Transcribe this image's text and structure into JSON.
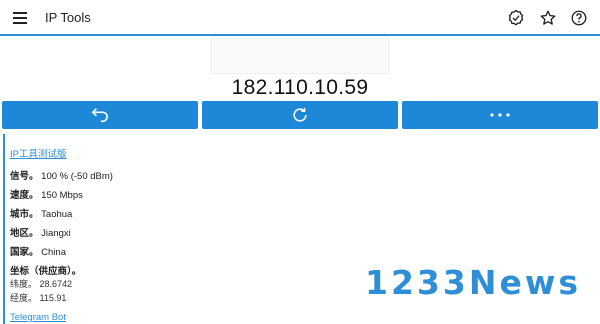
{
  "app": {
    "title": "IP Tools",
    "accent": "#2f8fd6",
    "button_color": "#1e88d8",
    "icons": {
      "menu": "hamburger-menu-icon",
      "verify": "verified-badge-icon",
      "star": "star-icon",
      "help": "help-icon",
      "back": "back-arrow-icon",
      "refresh": "refresh-icon",
      "more": "more-dots-icon"
    }
  },
  "ip_address": "182.110.10.59",
  "links": {
    "test_version": "IP工具测试版",
    "telegram_bot": "Telegram Bot"
  },
  "info": {
    "signal": {
      "label": "信号。",
      "value": "100 % (-50 dBm)"
    },
    "speed": {
      "label": "速度。",
      "value": "150 Mbps"
    },
    "city": {
      "label": "城市。",
      "value": "Taohua"
    },
    "region": {
      "label": "地区。",
      "value": "Jiangxi"
    },
    "country": {
      "label": "国家。",
      "value": "China"
    },
    "coords": {
      "label": "坐标（供应商）。",
      "lat_label": "纬度。",
      "lat_value": "28.6742",
      "lon_label": "经度。",
      "lon_value": "115.91"
    }
  },
  "watermark": "1233News"
}
